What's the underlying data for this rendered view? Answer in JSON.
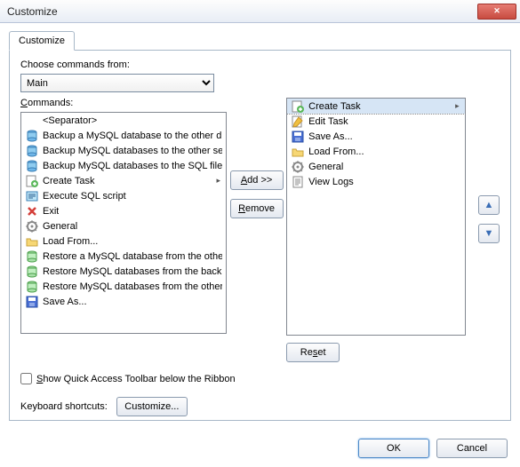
{
  "window": {
    "title": "Customize"
  },
  "tab": {
    "label": "Customize"
  },
  "labels": {
    "chooseFrom": "Choose commands from:",
    "commands": "Commands:",
    "add": "Add >>",
    "remove": "Remove",
    "reset": "Reset",
    "showQAT": "Show Quick Access Toolbar below the Ribbon",
    "kbShortcuts": "Keyboard shortcuts:",
    "customize": "Customize...",
    "ok": "OK",
    "cancel": "Cancel"
  },
  "combo": {
    "selected": "Main"
  },
  "leftList": [
    {
      "icon": "",
      "label": "<Separator>"
    },
    {
      "icon": "db-icon",
      "label": "Backup a MySQL database to the other d"
    },
    {
      "icon": "db-icon",
      "label": "Backup MySQL databases to the other se"
    },
    {
      "icon": "db-icon",
      "label": "Backup MySQL databases to the SQL file"
    },
    {
      "icon": "create-icon",
      "label": "Create Task",
      "sub": true
    },
    {
      "icon": "sql-icon",
      "label": "Execute SQL script"
    },
    {
      "icon": "exit-icon",
      "label": "Exit"
    },
    {
      "icon": "gear-icon",
      "label": "General"
    },
    {
      "icon": "folder-icon",
      "label": "Load From..."
    },
    {
      "icon": "restore-icon",
      "label": "Restore a MySQL database from the other"
    },
    {
      "icon": "restore-icon",
      "label": "Restore MySQL databases from the backu"
    },
    {
      "icon": "restore-icon",
      "label": "Restore MySQL databases from the other"
    },
    {
      "icon": "save-icon",
      "label": "Save As..."
    }
  ],
  "rightList": [
    {
      "icon": "create-icon",
      "label": "Create Task",
      "sub": true,
      "selected": true
    },
    {
      "icon": "edit-icon",
      "label": "Edit Task"
    },
    {
      "icon": "save-icon",
      "label": "Save As..."
    },
    {
      "icon": "folder-icon",
      "label": "Load From..."
    },
    {
      "icon": "gear-icon",
      "label": "General"
    },
    {
      "icon": "log-icon",
      "label": "View Logs"
    }
  ]
}
